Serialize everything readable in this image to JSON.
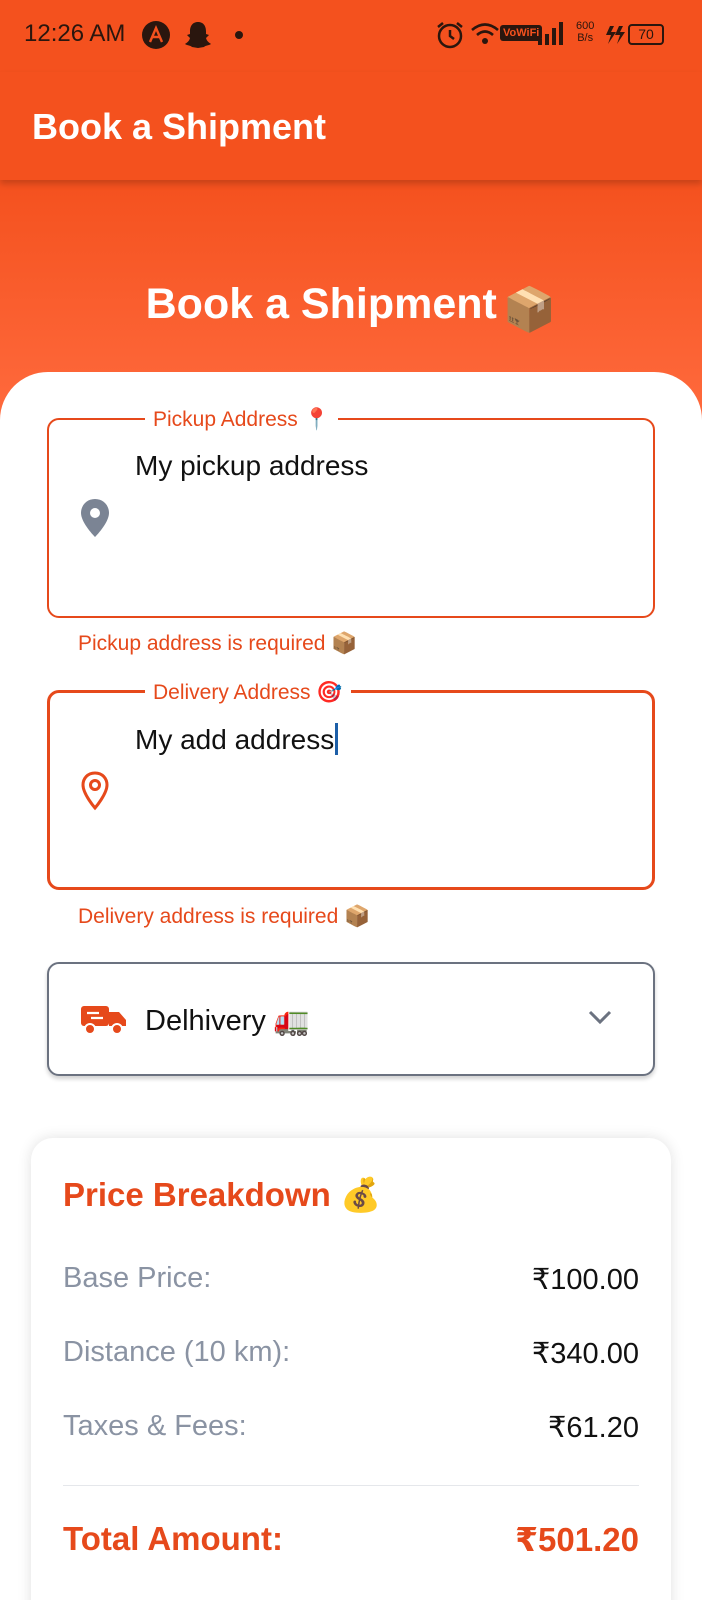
{
  "status_bar": {
    "time": "12:26 AM",
    "network_label": "VoWiFi",
    "speed_value": "600",
    "speed_unit": "B/s",
    "battery": "70",
    "icons": [
      "a-app-icon",
      "snapchat-icon",
      "dot-icon",
      "alarm-icon",
      "wifi-icon",
      "signal-icon",
      "charging-icon",
      "battery-icon"
    ]
  },
  "app_bar": {
    "title": "Book a Shipment"
  },
  "hero": {
    "title": "Book a Shipment",
    "emoji": "📦"
  },
  "pickup": {
    "label": "Pickup Address 📍",
    "value": "My pickup address",
    "error": "Pickup address is required 📦",
    "icon": "map-pin-icon"
  },
  "delivery": {
    "label": "Delivery Address 🎯",
    "value": "My add address",
    "error": "Delivery address is required 📦",
    "icon": "location-outline-icon"
  },
  "courier": {
    "selected": "Delhivery 🚛",
    "icon": "truck-icon"
  },
  "price": {
    "title": "Price Breakdown 💰",
    "rows": [
      {
        "label": "Base Price:",
        "amount": "₹100.00"
      },
      {
        "label": "Distance (10 km):",
        "amount": "₹340.00"
      },
      {
        "label": "Taxes & Fees:",
        "amount": "₹61.20"
      }
    ],
    "total_label": "Total Amount:",
    "total_amount": "₹501.20"
  },
  "colors": {
    "primary": "#f4511e",
    "accent_text": "#e6491b",
    "muted": "#8a93a3",
    "caret": "#1d5fa8"
  }
}
